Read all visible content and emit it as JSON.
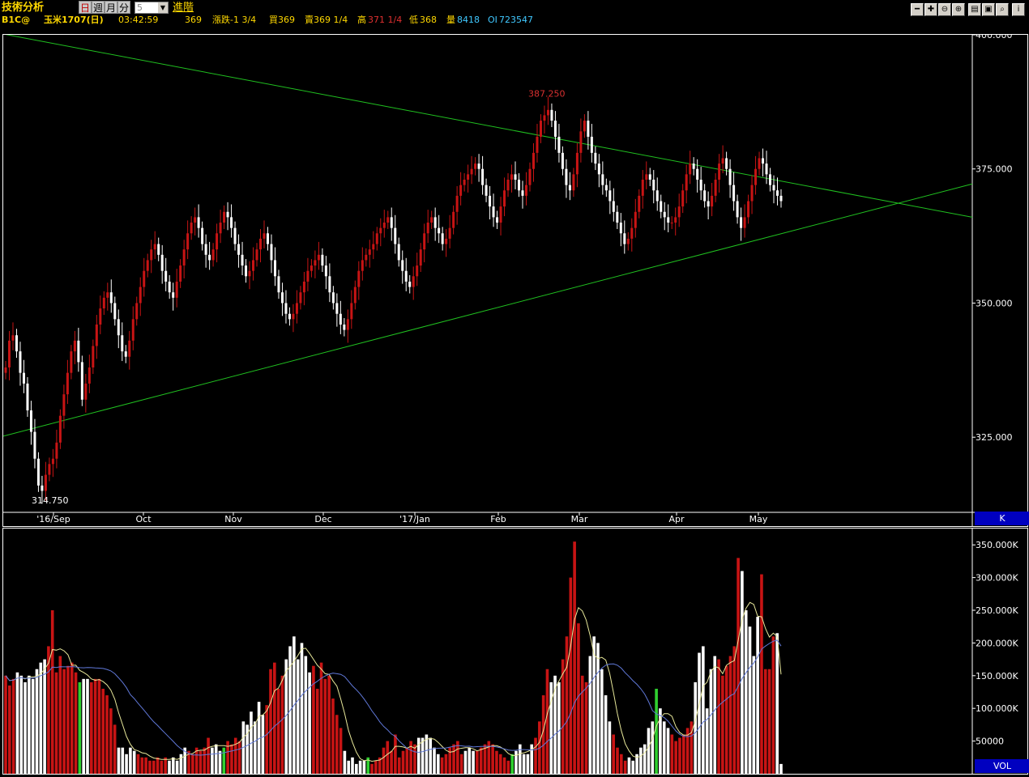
{
  "toolbar": {
    "title": "技術分析",
    "period_daily": "日",
    "period_weekly": "週",
    "period_monthly": "月",
    "period_minute": "分",
    "period_value": "5",
    "advanced_label": "進階"
  },
  "quote": {
    "symbol": "B1C@",
    "name": "玉米1707(日)",
    "time": "03:42:59",
    "last": "369",
    "change_label": "漲跌-1 3/4",
    "bid_label": "買369",
    "ask_label": "賣369 1/4",
    "high_label": "高",
    "high_value": "371 1/4",
    "low_label": "低",
    "low_value": "368",
    "volume_label": "量",
    "volume_value": "8418",
    "oi_label": "OI",
    "oi_value": "723547"
  },
  "colors": {
    "up": "#c81414",
    "down": "#ffffff",
    "trendline": "#20c020",
    "ma_short": "#e8e89a",
    "ma_long": "#6078d8",
    "highlight_high": "#d83030"
  },
  "chart_data": [
    {
      "type": "candlestick",
      "pane_label": "K",
      "x_ticks": [
        "'16/Sep",
        "Oct",
        "Nov",
        "Dec",
        "'17/Jan",
        "Feb",
        "Mar",
        "Apr",
        "May"
      ],
      "y_ticks": [
        "400.000",
        "375.000",
        "350.000",
        "325.000"
      ],
      "ylim": [
        311,
        400
      ],
      "annotations": {
        "high": "387.250",
        "low": "314.750"
      },
      "series": [
        {
          "name": "price",
          "values": [
            338,
            343,
            344,
            341,
            337,
            335,
            330,
            326,
            321,
            316,
            315,
            318,
            320,
            321,
            324,
            329,
            333,
            337,
            341,
            343,
            339,
            332,
            335,
            338,
            342,
            346,
            349,
            351,
            352,
            350,
            347,
            344,
            341,
            340,
            343,
            347,
            350,
            353,
            356,
            358,
            360,
            361,
            359,
            356,
            354,
            352,
            351,
            354,
            357,
            360,
            363,
            365,
            366,
            364,
            361,
            359,
            358,
            360,
            363,
            365,
            367,
            366,
            364,
            361,
            359,
            357,
            355,
            356,
            358,
            360,
            362,
            363,
            361,
            358,
            355,
            352,
            350,
            348,
            347,
            348,
            350,
            352,
            354,
            356,
            357,
            358,
            359,
            357,
            355,
            352,
            350,
            348,
            346,
            345,
            347,
            350,
            353,
            356,
            358,
            359,
            360,
            361,
            363,
            364,
            365,
            366,
            364,
            361,
            358,
            356,
            354,
            353,
            355,
            357,
            360,
            363,
            365,
            366,
            364,
            363,
            361,
            362,
            364,
            367,
            370,
            372,
            373,
            374,
            375,
            376,
            375,
            372,
            370,
            368,
            366,
            365,
            368,
            371,
            373,
            374,
            373,
            371,
            370,
            372,
            375,
            378,
            381,
            384,
            385,
            386,
            384,
            381,
            378,
            375,
            372,
            371,
            374,
            378,
            382,
            384,
            381,
            378,
            376,
            374,
            372,
            371,
            369,
            367,
            365,
            363,
            361,
            362,
            364,
            367,
            370,
            373,
            374,
            373,
            371,
            369,
            367,
            366,
            365,
            365,
            366,
            368,
            371,
            374,
            376,
            375,
            373,
            371,
            369,
            368,
            370,
            373,
            376,
            377,
            375,
            372,
            369,
            366,
            364,
            366,
            369,
            372,
            375,
            377,
            376,
            374,
            372,
            371,
            370,
            369
          ]
        },
        {
          "name": "trendline_upper",
          "values": [
            [
              0,
              400
            ],
            [
              1197,
              366
            ]
          ]
        },
        {
          "name": "trendline_lower",
          "values": [
            [
              0,
              325
            ],
            [
              1197,
              372
            ]
          ]
        }
      ]
    },
    {
      "type": "bar",
      "pane_label": "VOL",
      "y_ticks": [
        "350.000K",
        "300.000K",
        "250.000K",
        "200.000K",
        "150.000K",
        "100.000K",
        "50000"
      ],
      "ylim": [
        0,
        375000
      ],
      "series": [
        {
          "name": "volume",
          "values": [
            150,
            135,
            145,
            155,
            150,
            140,
            150,
            145,
            160,
            170,
            175,
            195,
            250,
            155,
            180,
            160,
            165,
            170,
            155,
            140,
            145,
            145,
            140,
            145,
            145,
            130,
            120,
            100,
            75,
            40,
            40,
            30,
            40,
            35,
            30,
            25,
            25,
            20,
            20,
            25,
            20,
            25,
            20,
            25,
            20,
            30,
            40,
            35,
            30,
            40,
            35,
            40,
            55,
            40,
            45,
            35,
            40,
            50,
            45,
            55,
            50,
            80,
            75,
            95,
            80,
            110,
            90,
            105,
            160,
            170,
            130,
            150,
            175,
            195,
            210,
            175,
            200,
            180,
            155,
            165,
            130,
            170,
            145,
            150,
            115,
            90,
            70,
            35,
            20,
            25,
            15,
            20,
            20,
            25,
            15,
            20,
            25,
            40,
            50,
            35,
            60,
            25,
            35,
            40,
            50,
            45,
            55,
            55,
            60,
            55,
            40,
            30,
            25,
            30,
            40,
            45,
            50,
            30,
            35,
            40,
            35,
            35,
            40,
            45,
            50,
            45,
            35,
            30,
            25,
            20,
            30,
            35,
            45,
            30,
            30,
            45,
            55,
            80,
            120,
            160,
            140,
            150,
            140,
            175,
            210,
            300,
            355,
            230,
            150,
            140,
            180,
            210,
            200,
            160,
            120,
            80,
            60,
            40,
            30,
            20,
            25,
            20,
            30,
            40,
            45,
            70,
            80,
            130,
            100,
            80,
            70,
            60,
            50,
            55,
            60,
            70,
            80,
            140,
            185,
            195,
            100,
            160,
            180,
            175,
            150,
            165,
            180,
            195,
            330,
            310,
            250,
            225,
            180,
            240,
            305,
            160,
            160,
            210,
            215,
            15
          ]
        },
        {
          "name": "ma_short",
          "values": []
        },
        {
          "name": "ma_long",
          "values": []
        }
      ]
    }
  ]
}
